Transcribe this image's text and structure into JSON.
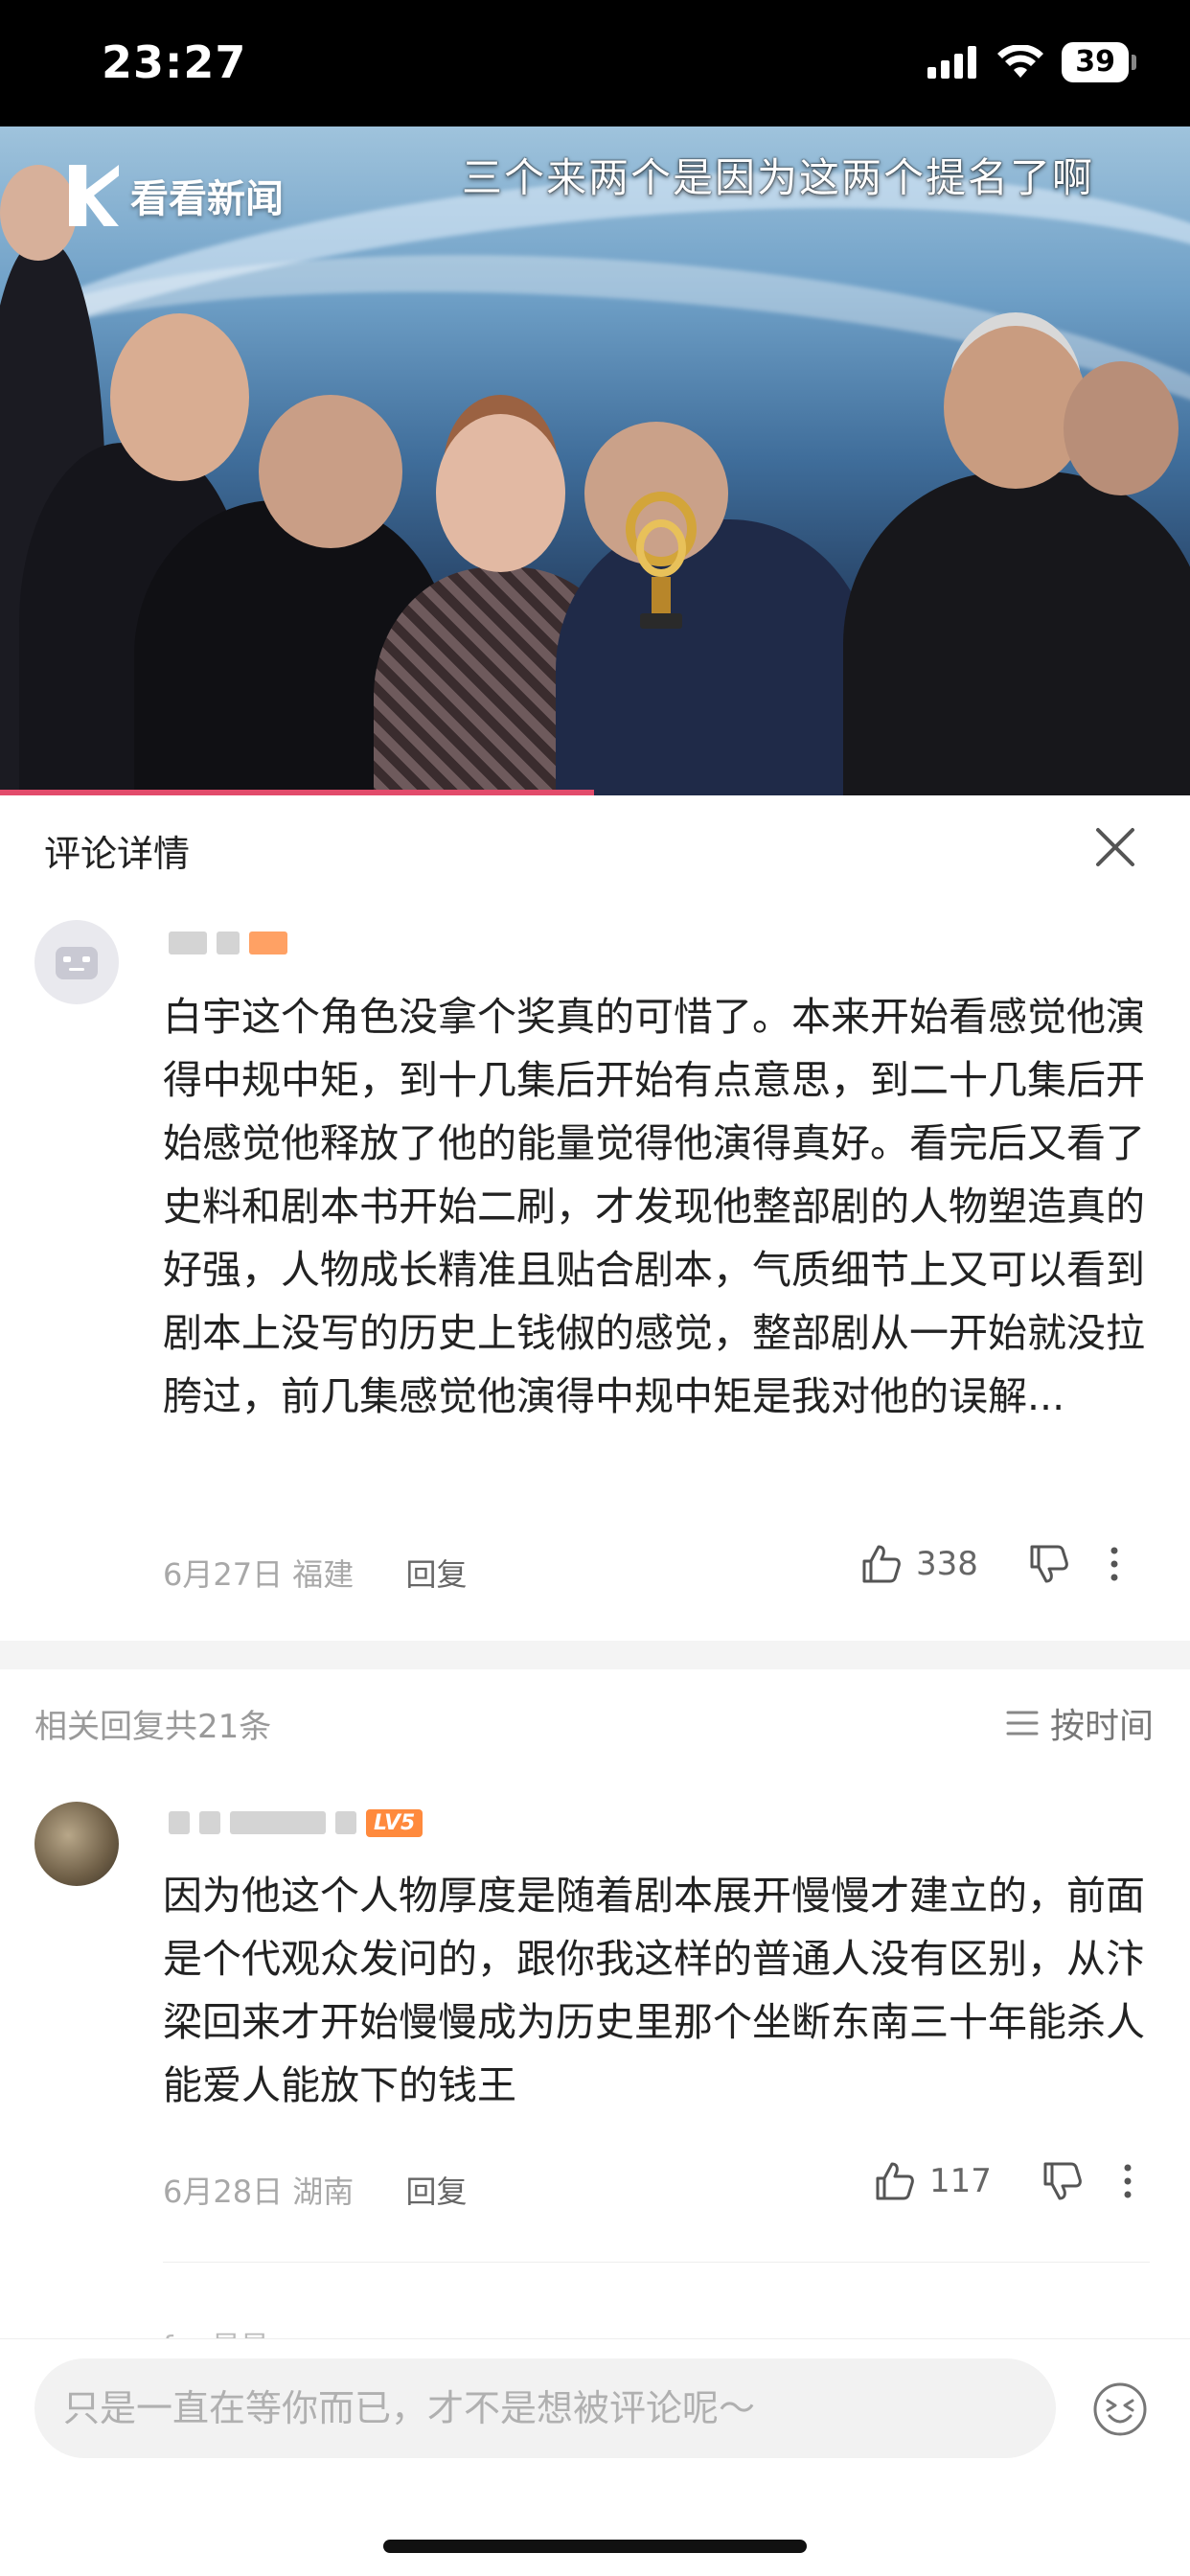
{
  "status_bar": {
    "time": "23:27",
    "battery": "39"
  },
  "video": {
    "logo_text": "看看新闻",
    "caption": "三个来两个是因为这两个提名了啊"
  },
  "panel": {
    "title": "评论详情"
  },
  "main_comment": {
    "text": "白宇这个角色没拿个奖真的可惜了。本来开始看感觉他演得中规中矩，到十几集后开始有点意思，到二十几集后开始感觉他释放了他的能量觉得他演得真好。看完后又看了史料和剧本书开始二刷，才发现他整部剧的人物塑造真的好强，人物成长精准且贴合剧本，气质细节上又可以看到剧本上没写的历史上钱俶的感觉，整部剧从一开始就没拉胯过，前几集感觉他演得中规中矩是我对他的误解...",
    "date": "6月27日",
    "location": "福建",
    "reply_label": "回复",
    "likes": "338"
  },
  "replies_header": {
    "count_text": "相关回复共21条",
    "sort_label": "按时间"
  },
  "replies": [
    {
      "level_badge": "LV5",
      "text": "因为他这个人物厚度是随着剧本展开慢慢才建立的，前面是个代观众发问的，跟你我这样的普通人没有区别，从汴梁回来才开始慢慢成为历史里那个坐断东南三十年能杀人能爱人能放下的钱王",
      "date": "6月28日",
      "location": "湖南",
      "reply_label": "回复",
      "likes": "117"
    }
  ],
  "peek_username": "for 星星",
  "input": {
    "placeholder": "只是一直在等你而已，才不是想被评论呢～"
  },
  "colors": {
    "accent": "#ff8a3d",
    "progress": "#e24b6b"
  }
}
